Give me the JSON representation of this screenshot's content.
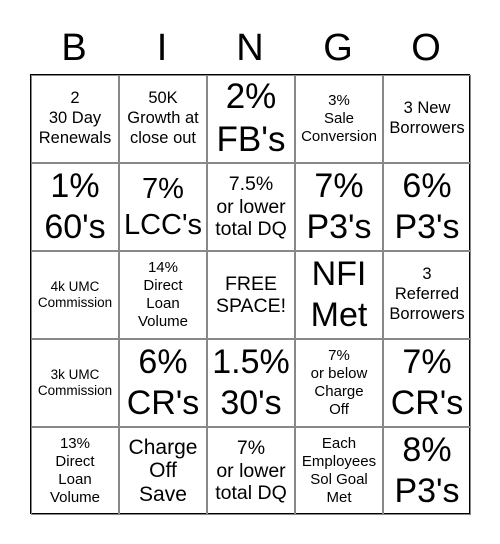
{
  "header": [
    "B",
    "I",
    "N",
    "G",
    "O"
  ],
  "cells": [
    "2\n30 Day\nRenewals",
    "50K\nGrowth at\nclose out",
    "2%\nFB's",
    "3%\nSale\nConversion",
    "3 New\nBorrowers",
    "1%\n60's",
    "7%\nLCC's",
    "7.5%\nor lower\ntotal DQ",
    "7%\nP3's",
    "6%\nP3's",
    "4k UMC\nCommission",
    "14%\nDirect\nLoan\nVolume",
    "FREE\nSPACE!",
    "NFI\nMet",
    "3\nReferred\nBorrowers",
    "3k UMC\nCommission",
    "6%\nCR's",
    "1.5%\n30's",
    "7%\nor below\nCharge\nOff",
    "7%\nCR's",
    "13%\nDirect\nLoan\nVolume",
    "Charge\nOff\nSave",
    "7%\nor lower\ntotal DQ",
    "Each\nEmployees\nSol Goal\nMet",
    "8%\nP3's"
  ]
}
